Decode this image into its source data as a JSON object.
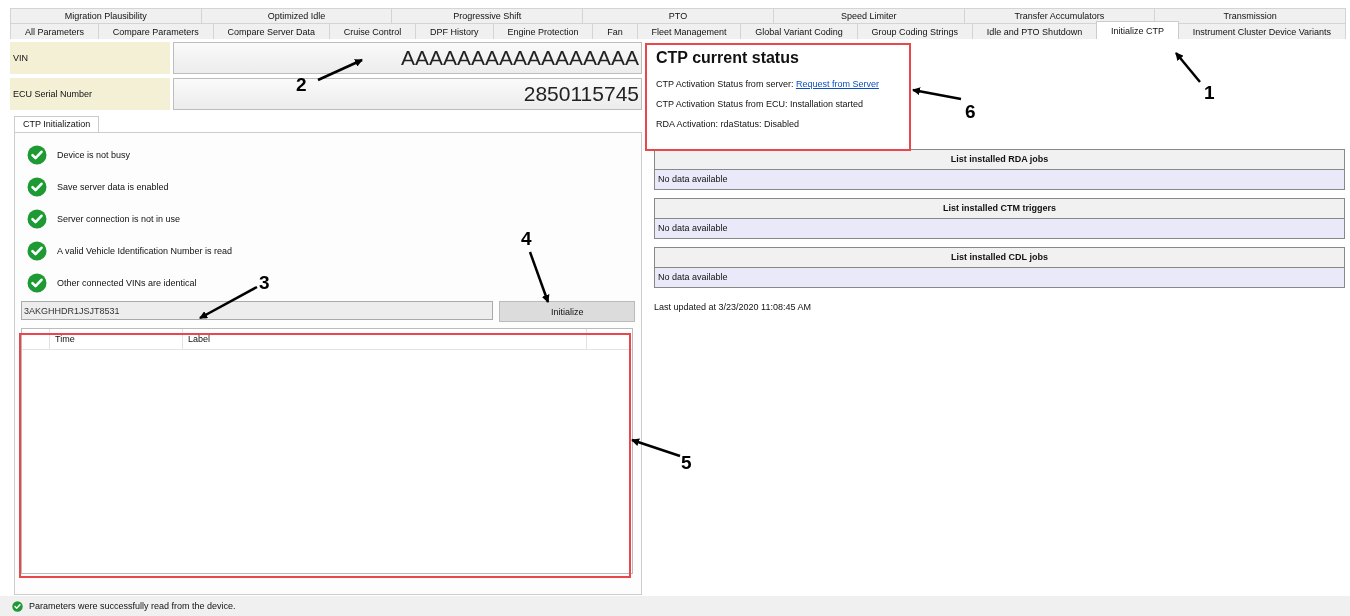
{
  "tab_rows": [
    [
      {
        "label": "Migration Plausibility",
        "selected": false
      },
      {
        "label": "Optimized Idle",
        "selected": false
      },
      {
        "label": "Progressive Shift",
        "selected": false
      },
      {
        "label": "PTO",
        "selected": false
      },
      {
        "label": "Speed Limiter",
        "selected": false
      },
      {
        "label": "Transfer Accumulators",
        "selected": false
      },
      {
        "label": "Transmission",
        "selected": false
      }
    ],
    [
      {
        "label": "All Parameters",
        "selected": false
      },
      {
        "label": "Compare Parameters",
        "selected": false
      },
      {
        "label": "Compare Server Data",
        "selected": false
      },
      {
        "label": "Cruise Control",
        "selected": false
      },
      {
        "label": "DPF History",
        "selected": false
      },
      {
        "label": "Engine Protection",
        "selected": false
      },
      {
        "label": "Fan",
        "selected": false
      },
      {
        "label": "Fleet Management",
        "selected": false
      },
      {
        "label": "Global Variant Coding",
        "selected": false
      },
      {
        "label": "Group Coding Strings",
        "selected": false
      },
      {
        "label": "Idle and PTO Shutdown",
        "selected": false
      },
      {
        "label": "Initialize CTP",
        "selected": true
      },
      {
        "label": "Instrument Cluster Device Variants",
        "selected": false
      }
    ]
  ],
  "fields": [
    {
      "label": "VIN",
      "value": "AAAAAAAAAAAAAAAAA"
    },
    {
      "label": "ECU Serial Number",
      "value": "2850115745"
    }
  ],
  "sub_tabs": [
    {
      "label": "CTP Initialization",
      "selected": true
    }
  ],
  "checks": [
    {
      "label": "Device is not busy",
      "passed": true
    },
    {
      "label": "Save server data is enabled",
      "passed": true
    },
    {
      "label": "Server connection is not in use",
      "passed": true
    },
    {
      "label": "A valid Vehicle Identification Number is read",
      "passed": true
    },
    {
      "label": "Other connected VINs are identical",
      "passed": true
    }
  ],
  "vin_field": {
    "value": "3AKGHHDR1JSJT8531"
  },
  "initialize_button": "Initialize",
  "log_table": {
    "columns": [
      "Time",
      "Label"
    ]
  },
  "status": {
    "title": "CTP current status",
    "lines": [
      {
        "text": "CTP Activation Status from server:",
        "link": "Request from Server"
      },
      {
        "text": "CTP Activation Status from ECU: Installation started"
      },
      {
        "text": "RDA Activation: rdaStatus: Disabled"
      }
    ]
  },
  "lists": [
    {
      "title": "List installed RDA jobs",
      "rows": [
        "No data available"
      ]
    },
    {
      "title": "List installed CTM triggers",
      "rows": [
        "No data available"
      ]
    },
    {
      "title": "List installed CDL jobs",
      "rows": [
        "No data available"
      ]
    }
  ],
  "last_updated": "Last updated at 3/23/2020 11:08:45 AM",
  "status_bar": {
    "message": "Parameters were successfully read from the device.",
    "ok": true
  },
  "annotations": [
    {
      "number": "1"
    },
    {
      "number": "2"
    },
    {
      "number": "3"
    },
    {
      "number": "4"
    },
    {
      "number": "5"
    },
    {
      "number": "6"
    }
  ]
}
